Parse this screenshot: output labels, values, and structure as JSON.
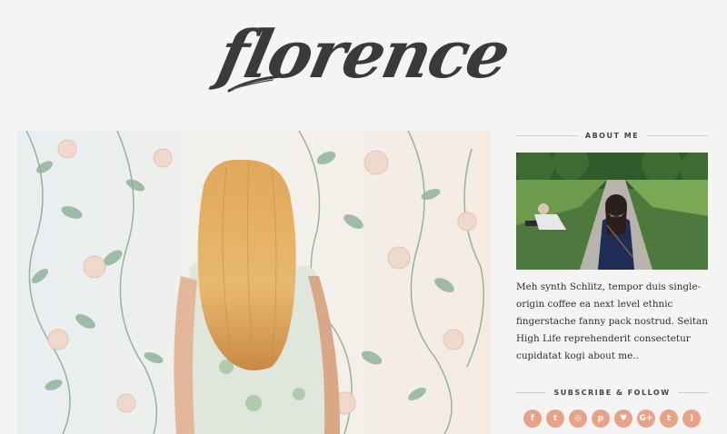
{
  "header": {
    "logo_text": "florence"
  },
  "sidebar": {
    "about": {
      "title": "ABOUT ME",
      "text": "Meh synth Schlitz, tempor duis single-origin coffee ea next level ethnic fingerstache fanny pack nostrud. Seitan High Life reprehenderit consectetur cupidatat kogi about me.."
    },
    "subscribe": {
      "title": "SUBSCRIBE & FOLLOW",
      "icons": [
        {
          "name": "facebook-icon",
          "glyph": "f"
        },
        {
          "name": "twitter-icon",
          "glyph": "t"
        },
        {
          "name": "instagram-icon",
          "glyph": "◎"
        },
        {
          "name": "pinterest-icon",
          "glyph": "p"
        },
        {
          "name": "bloglovin-icon",
          "glyph": "♥"
        },
        {
          "name": "google-plus-icon",
          "glyph": "G+"
        },
        {
          "name": "tumblr-icon",
          "glyph": "t"
        },
        {
          "name": "rss-icon",
          "glyph": ")"
        }
      ]
    }
  },
  "colors": {
    "background": "#f4f4f4",
    "accent": "#e8a287",
    "logo": "#3a3a3a"
  }
}
